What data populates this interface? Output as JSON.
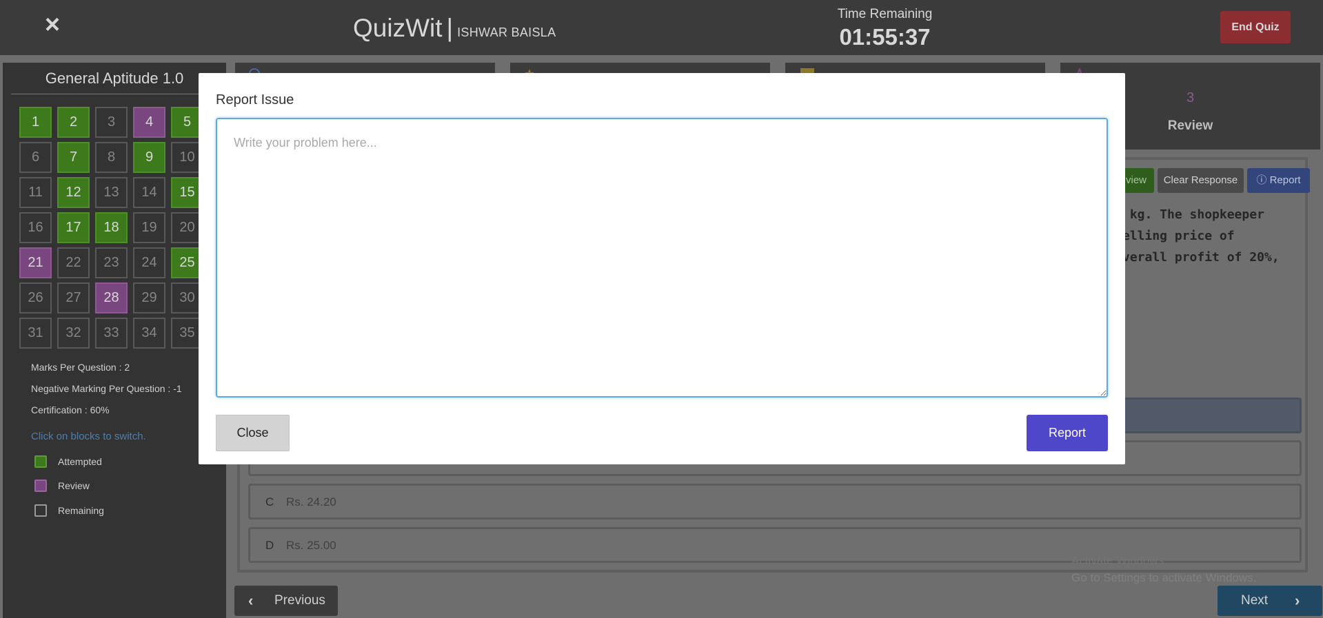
{
  "header": {
    "close_icon": "×",
    "app_name": "QuizWit",
    "separator": "|",
    "user_name": "ISHWAR BAISLA",
    "time_label": "Time Remaining",
    "time_value": "01:55:37",
    "end_quiz_label": "End Quiz"
  },
  "sidebar": {
    "title": "General Aptitude 1.0",
    "questions": [
      {
        "n": "1",
        "s": "attempted"
      },
      {
        "n": "2",
        "s": "attempted"
      },
      {
        "n": "3",
        "s": "remaining"
      },
      {
        "n": "4",
        "s": "review"
      },
      {
        "n": "5",
        "s": "attempted"
      },
      {
        "n": "6",
        "s": "remaining"
      },
      {
        "n": "7",
        "s": "attempted"
      },
      {
        "n": "8",
        "s": "remaining"
      },
      {
        "n": "9",
        "s": "attempted"
      },
      {
        "n": "10",
        "s": "remaining"
      },
      {
        "n": "11",
        "s": "remaining"
      },
      {
        "n": "12",
        "s": "attempted"
      },
      {
        "n": "13",
        "s": "remaining"
      },
      {
        "n": "14",
        "s": "remaining"
      },
      {
        "n": "15",
        "s": "attempted"
      },
      {
        "n": "16",
        "s": "remaining"
      },
      {
        "n": "17",
        "s": "attempted"
      },
      {
        "n": "18",
        "s": "attempted"
      },
      {
        "n": "19",
        "s": "remaining"
      },
      {
        "n": "20",
        "s": "remaining"
      },
      {
        "n": "21",
        "s": "review"
      },
      {
        "n": "22",
        "s": "remaining"
      },
      {
        "n": "23",
        "s": "remaining"
      },
      {
        "n": "24",
        "s": "remaining"
      },
      {
        "n": "25",
        "s": "attempted"
      },
      {
        "n": "26",
        "s": "remaining"
      },
      {
        "n": "27",
        "s": "remaining"
      },
      {
        "n": "28",
        "s": "review"
      },
      {
        "n": "29",
        "s": "remaining"
      },
      {
        "n": "30",
        "s": "remaining"
      },
      {
        "n": "31",
        "s": "remaining"
      },
      {
        "n": "32",
        "s": "remaining"
      },
      {
        "n": "33",
        "s": "remaining"
      },
      {
        "n": "34",
        "s": "remaining"
      },
      {
        "n": "35",
        "s": "remaining"
      }
    ],
    "marks_per_question": "Marks Per Question : 2",
    "negative_marking": "Negative Marking Per Question : -1",
    "certification": "Certification : 60%",
    "hint": "Click on blocks to switch.",
    "legend": {
      "attempted": "Attempted",
      "review": "Review",
      "remaining": "Remaining"
    }
  },
  "stats": {
    "review_count": "3",
    "review_label": "Review"
  },
  "question": {
    "review_button_fragment": "view",
    "clear_response_label": "Clear Response",
    "report_label": "Report",
    "report_icon": "info-circle-icon",
    "text_fragment": " kg. The shopkeeper\nelling price of\nverall profit of 20%,",
    "options": [
      {
        "letter": "C",
        "value": "Rs. 24.20"
      },
      {
        "letter": "D",
        "value": "Rs. 25.00"
      }
    ],
    "previous_label": "Previous",
    "next_label": "Next"
  },
  "watermark": {
    "line1": "Activate Windows",
    "line2": "Go to Settings to activate Windows."
  },
  "modal": {
    "title": "Report Issue",
    "textarea_placeholder": "Write your problem here...",
    "textarea_value": "",
    "close_label": "Close",
    "report_label": "Report"
  },
  "colors": {
    "attempted": "#3d7a1c",
    "review": "#7a467f",
    "report_button": "#4f47c9",
    "end_quiz": "#8c2d31"
  }
}
